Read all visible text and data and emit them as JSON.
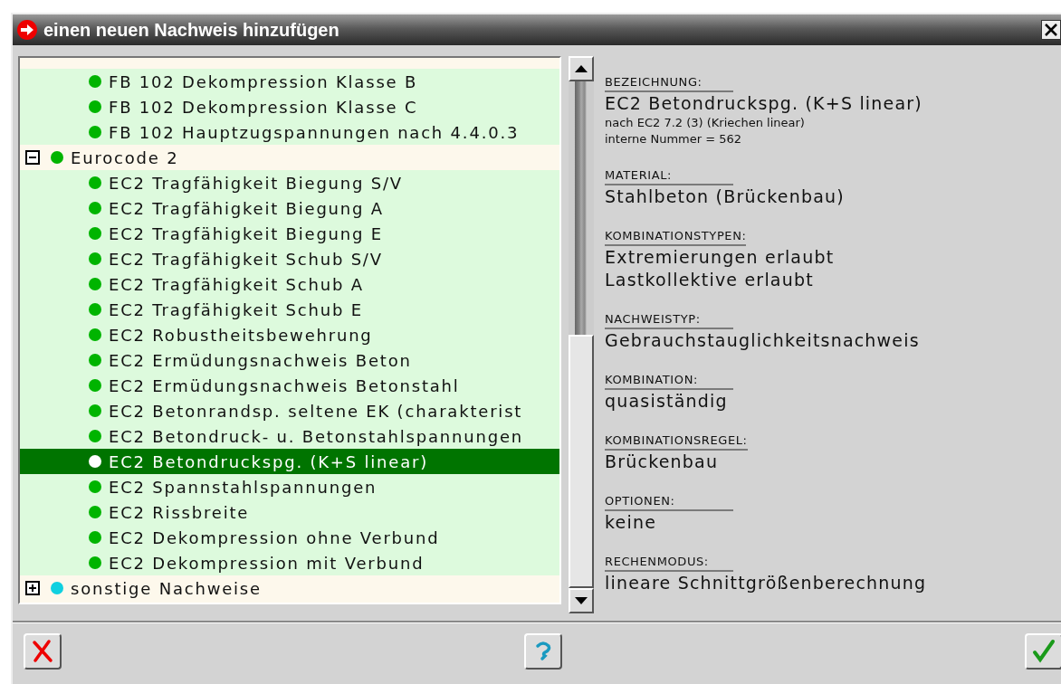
{
  "window": {
    "title": "einen neuen Nachweis hinzufügen"
  },
  "tree": [
    {
      "children": [
        {
          "label": "FB 102 Dekompression Klasse B",
          "selected": false
        },
        {
          "label": "FB 102 Dekompression Klasse C",
          "selected": false
        },
        {
          "label": "FB 102 Hauptzugspannungen nach 4.4.0.3",
          "selected": false
        }
      ]
    },
    {
      "label": "Eurocode 2",
      "expanded": true,
      "color": "#00b400",
      "children": [
        {
          "label": "EC2 Tragfähigkeit Biegung S/V",
          "selected": false
        },
        {
          "label": "EC2 Tragfähigkeit Biegung A",
          "selected": false
        },
        {
          "label": "EC2 Tragfähigkeit Biegung E",
          "selected": false
        },
        {
          "label": "EC2 Tragfähigkeit Schub S/V",
          "selected": false
        },
        {
          "label": "EC2 Tragfähigkeit Schub A",
          "selected": false
        },
        {
          "label": "EC2 Tragfähigkeit Schub E",
          "selected": false
        },
        {
          "label": "EC2 Robustheitsbewehrung",
          "selected": false
        },
        {
          "label": "EC2 Ermüdungsnachweis Beton",
          "selected": false
        },
        {
          "label": "EC2 Ermüdungsnachweis Betonstahl",
          "selected": false
        },
        {
          "label": "EC2 Betonrandsp. seltene EK (charakterist",
          "selected": false
        },
        {
          "label": "EC2 Betondruck- u. Betonstahlspannungen",
          "selected": false
        },
        {
          "label": "EC2 Betondruckspg. (K+S linear)",
          "selected": true
        },
        {
          "label": "EC2 Spannstahlspannungen",
          "selected": false
        },
        {
          "label": "EC2 Rissbreite",
          "selected": false
        },
        {
          "label": "EC2 Dekompression ohne Verbund",
          "selected": false
        },
        {
          "label": "EC2 Dekompression mit Verbund",
          "selected": false
        }
      ]
    },
    {
      "label": "sonstige Nachweise",
      "expanded": false,
      "color": "#10d0e0"
    }
  ],
  "details": [
    {
      "label": "BEZEICHNUNG:",
      "values": [
        "EC2 Betondruckspg. (K+S linear)"
      ],
      "notes": [
        "nach EC2 7.2 (3) (Kriechen linear)",
        "interne Nummer = 562"
      ]
    },
    {
      "label": "MATERIAL:",
      "values": [
        "Stahlbeton (Brückenbau)"
      ]
    },
    {
      "label": "KOMBINATIONSTYPEN:",
      "values": [
        "Extremierungen erlaubt",
        "Lastkollektive erlaubt"
      ]
    },
    {
      "label": "NACHWEISTYP:",
      "values": [
        "Gebrauchstauglichkeitsnachweis"
      ]
    },
    {
      "label": "KOMBINATION:",
      "values": [
        "quasiständig"
      ]
    },
    {
      "label": "KOMBINATIONSREGEL:",
      "values": [
        "Brückenbau"
      ]
    },
    {
      "label": "OPTIONEN:",
      "values": [
        "keine"
      ]
    },
    {
      "label": "RECHENMODUS:",
      "values": [
        "lineare Schnittgrößenberechnung"
      ]
    }
  ],
  "buttons": [
    {
      "kind": "cancel"
    },
    {
      "kind": "help"
    },
    {
      "kind": "ok"
    }
  ]
}
